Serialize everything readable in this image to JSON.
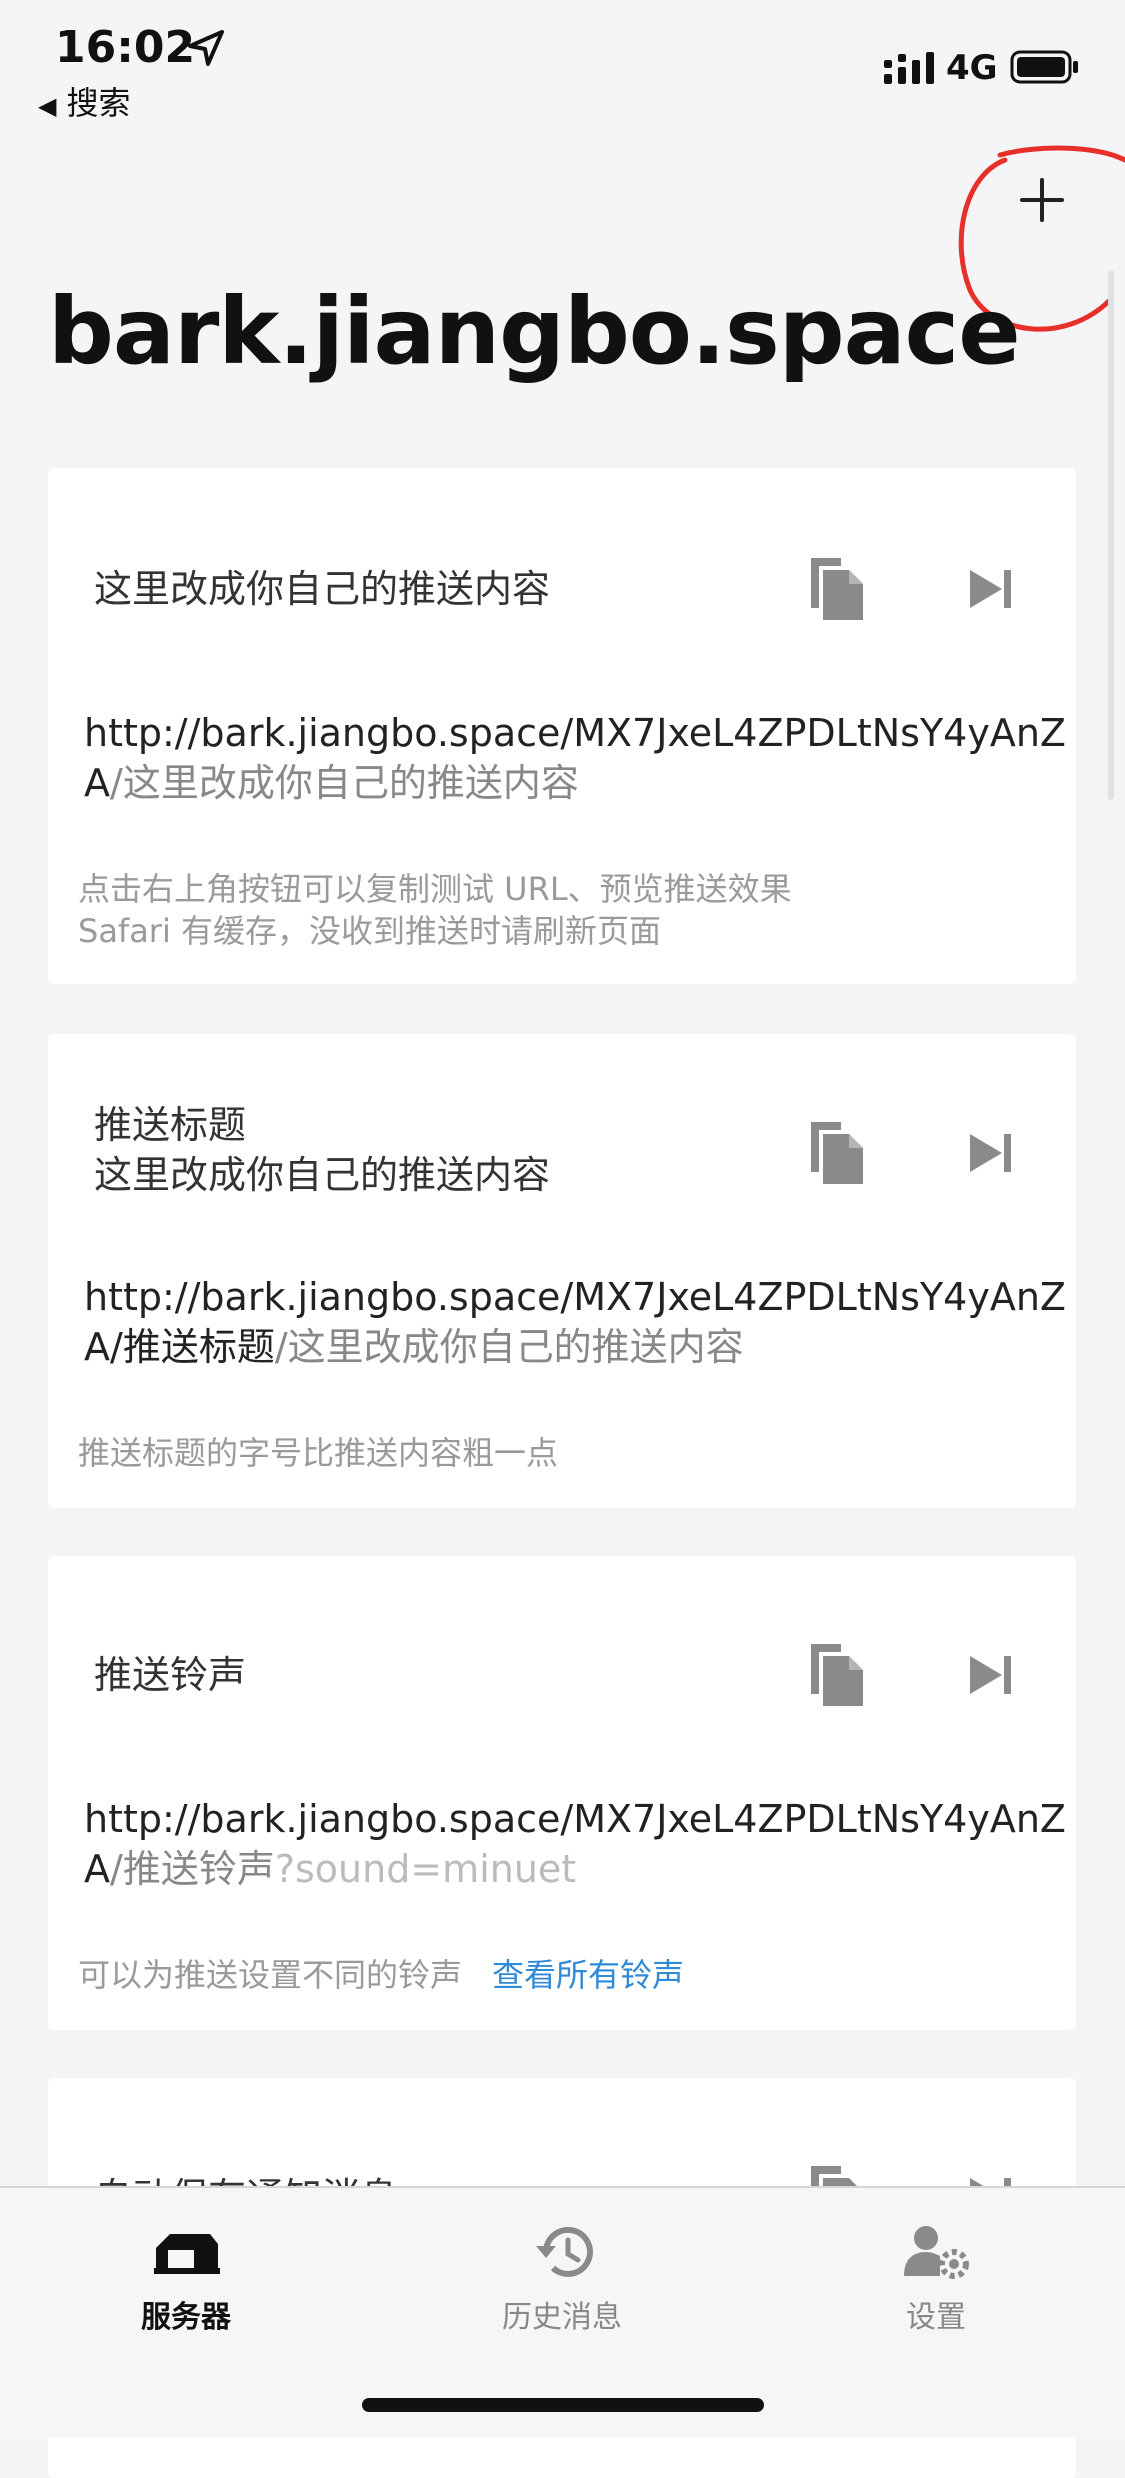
{
  "status": {
    "time": "16:02",
    "back_label": "搜索",
    "network": "4G"
  },
  "nav": {
    "title": "bark.jiangbo.space"
  },
  "cards": [
    {
      "title": "这里改成你自己的推送内容",
      "url_base": "http://bark.jiangbo.space/MX7JxeL4ZPDLtNsY4yAnZA",
      "url_slash": "/",
      "url_path": "这里改成你自己的推送内容",
      "note_line1": "点击右上角按钮可以复制测试 URL、预览推送效果",
      "note_line2": "Safari 有缓存，没收到推送时请刷新页面"
    },
    {
      "title_line1": "推送标题",
      "title_line2": "这里改成你自己的推送内容",
      "url_base": "http://bark.jiangbo.space/MX7JxeL4ZPDLtNsY4yAnZA/",
      "url_title": "推送标题",
      "url_slash": "/",
      "url_path": "这里改成你自己的推送内容",
      "note": "推送标题的字号比推送内容粗一点"
    },
    {
      "title": "推送铃声",
      "url_base": "http://bark.jiangbo.space/MX7JxeL4ZPDLtNsY4yAnZA",
      "url_slash": "/",
      "url_path": "推送铃声",
      "url_query": "?sound=minuet",
      "note": "可以为推送设置不同的铃声",
      "link": "查看所有铃声"
    },
    {
      "title": "自动保存通知消息"
    }
  ],
  "tabs": [
    {
      "label": "服务器",
      "icon": "server-icon",
      "active": true
    },
    {
      "label": "历史消息",
      "icon": "history-icon",
      "active": false
    },
    {
      "label": "设置",
      "icon": "settings-icon",
      "active": false
    }
  ],
  "colors": {
    "accent_link": "#2f8ad8",
    "background": "#f5f5f7",
    "card": "#ffffff",
    "annotation": "#e8302a"
  }
}
